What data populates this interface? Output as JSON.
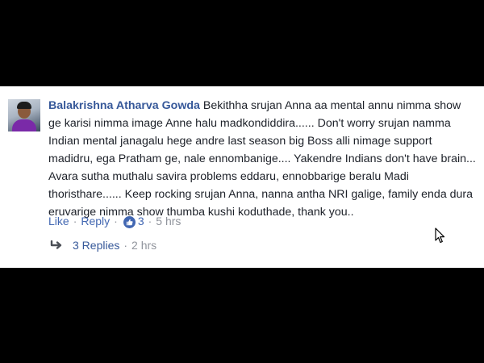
{
  "comment": {
    "author": "Balakrishna Atharva Gowda",
    "text": "Bekithha srujan Anna aa mental annu nimma show ge karisi nimma image Anne halu madkondiddira...... Don't worry srujan namma Indian mental janagalu hege andre last season big Boss alli nimage support madidru, ega Pratham ge, nale ennombanige.... Yakendre Indians don't have brain... Avara sutha muthalu savira problems eddaru, ennobbarige beralu Madi thoristhare...... Keep rocking srujan Anna, nanna antha NRI galige, family enda dura eruvarige nimma show thumba kushi koduthade, thank you..",
    "actions": {
      "like_label": "Like",
      "reply_label": "Reply",
      "reaction_count": "3",
      "timestamp": "5 hrs"
    },
    "replies": {
      "label": "3 Replies",
      "timestamp": "2 hrs"
    },
    "icons": {
      "reaction": "thumbs-up-icon",
      "reply": "reply-arrow-icon",
      "cursor": "mouse-pointer-icon"
    },
    "colors": {
      "author": "#365899",
      "link": "#4267b2",
      "muted": "#90949c",
      "text": "#1d2129"
    }
  }
}
